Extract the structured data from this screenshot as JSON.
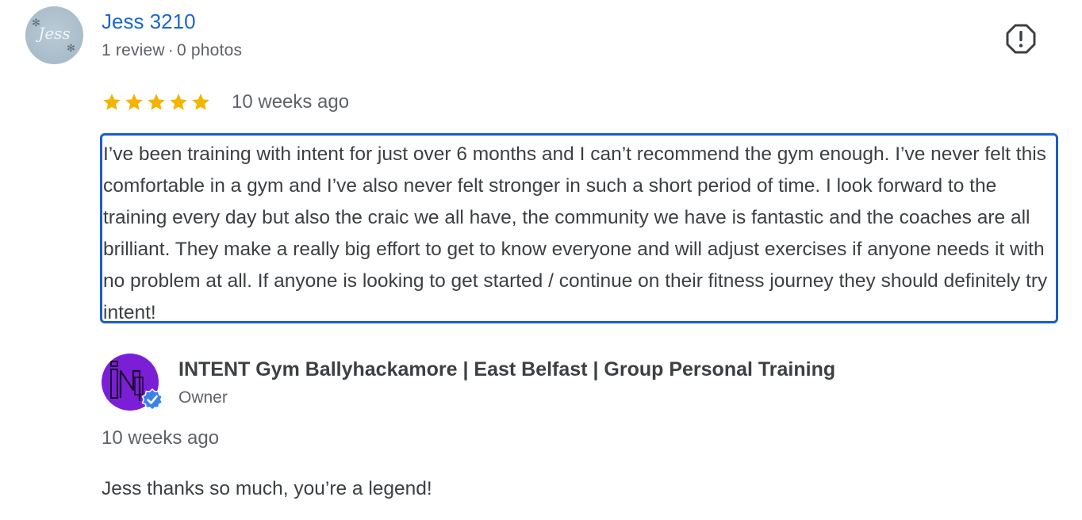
{
  "review": {
    "reviewer": {
      "name": "Jess 3210",
      "avatar_text": "Jess",
      "review_count": "1 review",
      "separator": "·",
      "photo_count": "0 photos"
    },
    "rating": {
      "stars": 5,
      "max_stars": 5,
      "star_color": "#f4b400"
    },
    "date": "10 weeks ago",
    "text": "I’ve been training with intent for just over 6 months and I can’t recommend the gym enough. I’ve never felt this comfortable in a gym and I’ve also never felt stronger in such a short period of time. I look forward to the training every day but also the craic we all have, the community we have is fantastic and the coaches are all brilliant. They make a really big effort to get to know everyone and will adjust exercises if anyone needs it with no problem at all. If anyone is looking to get started / continue on their fitness journey they should definitely try intent!",
    "report_icon": "report-flag-icon"
  },
  "owner_reply": {
    "owner_name": "INTENT Gym Ballyhackamore | East Belfast | Group Personal Training",
    "role": "Owner",
    "verified_icon": "verified-check-icon",
    "date": "10 weeks ago",
    "text": "Jess thanks so much, you’re a legend!"
  },
  "colors": {
    "link_blue": "#1a66d2",
    "focus_border": "#1b5fc9",
    "owner_logo_purple": "#7b1fd6",
    "verified_blue": "#3b82e8"
  }
}
